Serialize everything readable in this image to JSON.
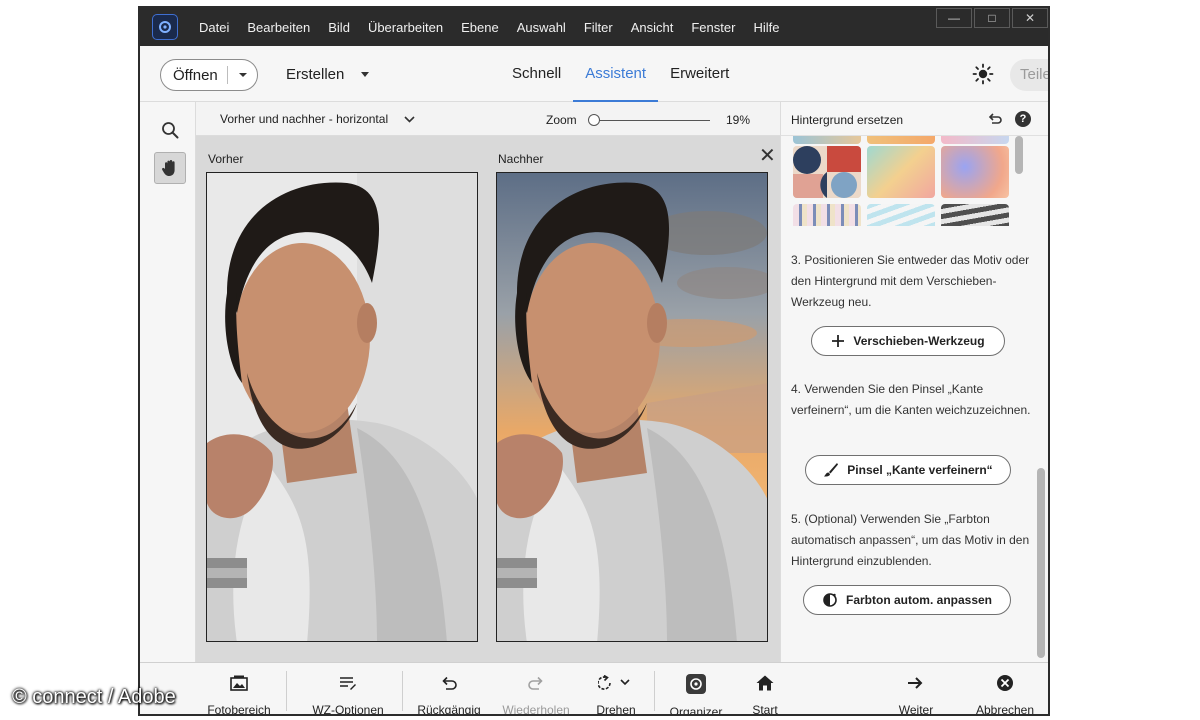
{
  "menu": {
    "items": [
      "Datei",
      "Bearbeiten",
      "Bild",
      "Überarbeiten",
      "Ebene",
      "Auswahl",
      "Filter",
      "Ansicht",
      "Fenster",
      "Hilfe"
    ]
  },
  "toolbar": {
    "open_label": "Öffnen",
    "create_label": "Erstellen",
    "modes": [
      {
        "label": "Schnell",
        "active": false
      },
      {
        "label": "Assistent",
        "active": true
      },
      {
        "label": "Erweitert",
        "active": false
      }
    ],
    "share_label": "Teile"
  },
  "options": {
    "view_mode": "Vorher und nachher - horizontal",
    "zoom_label": "Zoom",
    "zoom_value": "19%"
  },
  "canvas": {
    "before_label": "Vorher",
    "after_label": "Nachher"
  },
  "panel": {
    "title": "Hintergrund ersetzen",
    "step3": "3. Positionieren Sie entweder das Motiv oder den Hintergrund mit dem Verschieben-Werkzeug neu.",
    "button_move": "Verschieben-Werkzeug",
    "step4": "4. Verwenden Sie den Pinsel „Kante verfeinern“, um die Kanten weichzuzeichnen.",
    "button_refine": "Pinsel „Kante verfeinern“",
    "step5": "5. (Optional) Verwenden Sie „Farbton automatisch anpassen“, um das Motiv in den Hintergrund einzublenden.",
    "button_tone": "Farbton autom. anpassen"
  },
  "bottom": {
    "photo_bin": "Fotobereich",
    "tool_options": "WZ-Optionen",
    "undo": "Rückgängig",
    "redo": "Wiederholen",
    "rotate": "Drehen",
    "organizer": "Organizer",
    "home": "Start",
    "next": "Weiter",
    "cancel": "Abbrechen"
  },
  "watermark": "© connect / Adobe",
  "colors": {
    "accent": "#3c7bd6",
    "menubar": "#2b2b2b"
  }
}
